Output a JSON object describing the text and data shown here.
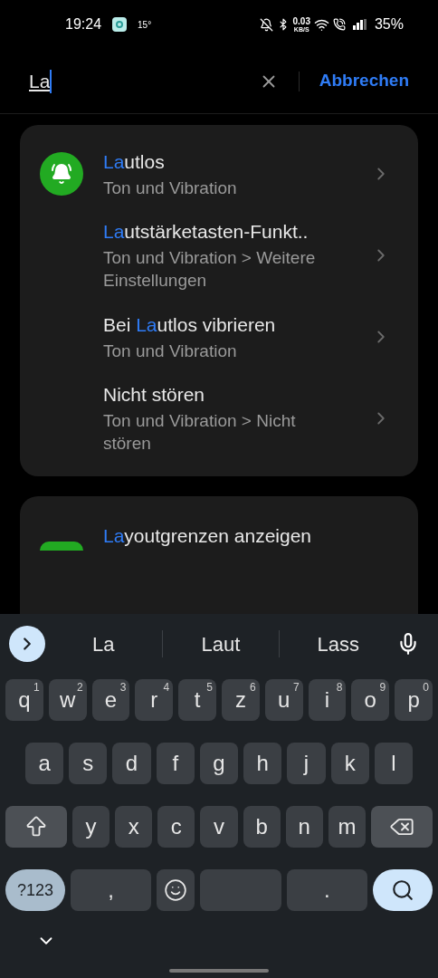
{
  "status_bar": {
    "time": "19:24",
    "temperature": "15°",
    "speed_value": "0.03",
    "speed_unit": "KB/S",
    "battery": "35%"
  },
  "search": {
    "value": "La",
    "cancel": "Abbrechen"
  },
  "results": [
    {
      "has_icon": true,
      "match": "La",
      "after": "utlos",
      "path": "Ton und Vibration"
    },
    {
      "has_icon": false,
      "match": "La",
      "after": "utstärketasten-Funkt..",
      "path": "Ton und Vibration > Weitere Einstellungen"
    },
    {
      "has_icon": false,
      "before": "Bei ",
      "match": "La",
      "after": "utlos vibrieren",
      "path": "Ton und Vibration"
    },
    {
      "has_icon": false,
      "before": "Nicht stören",
      "path": "Ton und Vibration > Nicht stören"
    }
  ],
  "next_result": {
    "match": "La",
    "after": "youtgrenzen anzeigen"
  },
  "suggestions": [
    "La",
    "Laut",
    "Lass"
  ],
  "keyboard": {
    "rows": [
      [
        {
          "kind": "letter",
          "label": "q",
          "digit": "1"
        },
        {
          "kind": "letter",
          "label": "w",
          "digit": "2"
        },
        {
          "kind": "letter",
          "label": "e",
          "digit": "3"
        },
        {
          "kind": "letter",
          "label": "r",
          "digit": "4"
        },
        {
          "kind": "letter",
          "label": "t",
          "digit": "5"
        },
        {
          "kind": "letter",
          "label": "z",
          "digit": "6"
        },
        {
          "kind": "letter",
          "label": "u",
          "digit": "7"
        },
        {
          "kind": "letter",
          "label": "i",
          "digit": "8"
        },
        {
          "kind": "letter",
          "label": "o",
          "digit": "9"
        },
        {
          "kind": "letter",
          "label": "p",
          "digit": "0"
        }
      ],
      [
        {
          "kind": "letter",
          "label": "a"
        },
        {
          "kind": "letter",
          "label": "s"
        },
        {
          "kind": "letter",
          "label": "d"
        },
        {
          "kind": "letter",
          "label": "f"
        },
        {
          "kind": "letter",
          "label": "g"
        },
        {
          "kind": "letter",
          "label": "h"
        },
        {
          "kind": "letter",
          "label": "j"
        },
        {
          "kind": "letter",
          "label": "k"
        },
        {
          "kind": "letter",
          "label": "l"
        }
      ],
      [
        {
          "kind": "shift"
        },
        {
          "kind": "letter",
          "label": "y"
        },
        {
          "kind": "letter",
          "label": "x"
        },
        {
          "kind": "letter",
          "label": "c"
        },
        {
          "kind": "letter",
          "label": "v"
        },
        {
          "kind": "letter",
          "label": "b"
        },
        {
          "kind": "letter",
          "label": "n"
        },
        {
          "kind": "letter",
          "label": "m"
        },
        {
          "kind": "backspace"
        }
      ],
      [
        {
          "kind": "symbols",
          "label": "?123"
        },
        {
          "kind": "letter",
          "label": ","
        },
        {
          "kind": "emoji"
        },
        {
          "kind": "space"
        },
        {
          "kind": "letter",
          "label": "."
        },
        {
          "kind": "search"
        }
      ]
    ]
  }
}
